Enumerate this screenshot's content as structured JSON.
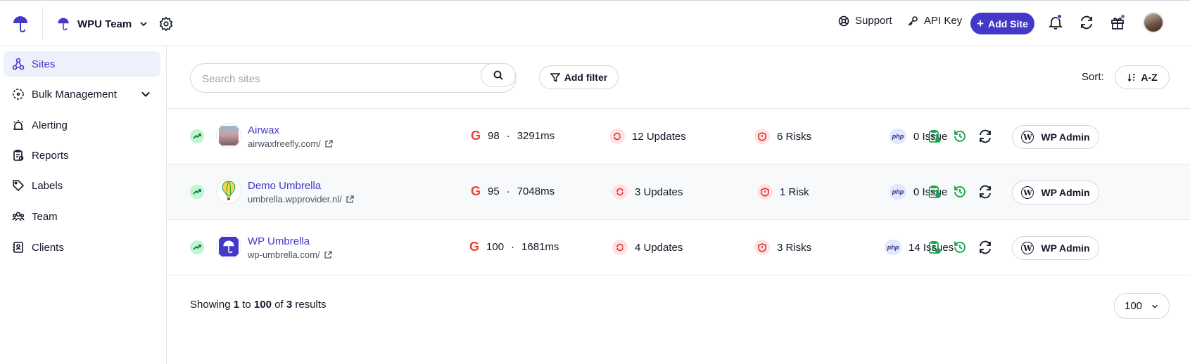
{
  "header": {
    "team_name": "WPU Team",
    "support_label": "Support",
    "api_key_label": "API Key",
    "add_site_label": "Add Site"
  },
  "sidebar": {
    "items": [
      {
        "label": "Sites",
        "icon": "sites-icon",
        "active": true
      },
      {
        "label": "Bulk Management",
        "icon": "bulk-icon"
      },
      {
        "label": "Alerting",
        "icon": "alert-icon"
      },
      {
        "label": "Reports",
        "icon": "reports-icon"
      },
      {
        "label": "Labels",
        "icon": "tag-icon"
      },
      {
        "label": "Team",
        "icon": "team-icon"
      },
      {
        "label": "Clients",
        "icon": "clients-icon"
      }
    ]
  },
  "toolbar": {
    "search_placeholder": "Search sites",
    "add_filter_label": "Add filter",
    "sort_label": "Sort:",
    "sort_value": "A-Z"
  },
  "sites": [
    {
      "name": "Airwax",
      "url": "airwaxfreefly.com/",
      "score": "98",
      "time": "3291ms",
      "updates": "12 Updates",
      "risks": "6 Risks",
      "issues": "0 Issue",
      "wp_admin": "WP Admin"
    },
    {
      "name": "Demo Umbrella",
      "url": "umbrella.wpprovider.nl/",
      "score": "95",
      "time": "7048ms",
      "updates": "3 Updates",
      "risks": "1 Risk",
      "issues": "0 Issue",
      "wp_admin": "WP Admin"
    },
    {
      "name": "WP Umbrella",
      "url": "wp-umbrella.com/",
      "score": "100",
      "time": "1681ms",
      "updates": "4 Updates",
      "risks": "3 Risks",
      "issues": "14 Issues",
      "wp_admin": "WP Admin"
    }
  ],
  "pagination": {
    "showing": "Showing",
    "from": "1",
    "to_word": "to",
    "to": "100",
    "of_word": "of",
    "total": "3",
    "results_word": "results",
    "page_size": "100"
  },
  "colors": {
    "accent": "#4338ca",
    "success": "#16a34a",
    "danger": "#dc2626"
  }
}
